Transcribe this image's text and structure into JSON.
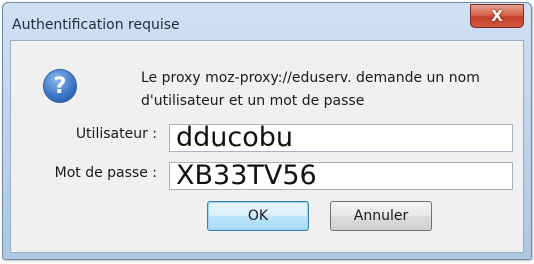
{
  "window": {
    "title": "Authentification requise",
    "close_glyph": "X"
  },
  "dialog": {
    "icon": "question-icon",
    "icon_glyph": "?",
    "message_line1": "Le proxy moz-proxy://eduserv. demande un nom",
    "message_line2": "d'utilisateur et un mot de passe"
  },
  "form": {
    "username_label": "Utilisateur :",
    "username_value": "dducobu",
    "password_label": "Mot de passe :",
    "password_value": "XB33TV56"
  },
  "buttons": {
    "ok_label": "OK",
    "cancel_label": "Annuler"
  }
}
